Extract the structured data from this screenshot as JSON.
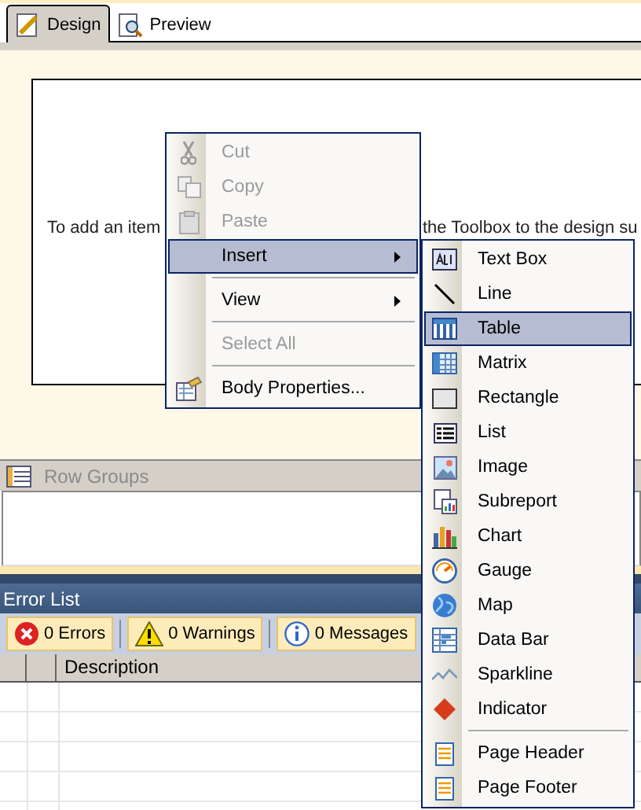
{
  "tabs": [
    {
      "label": "Design",
      "selected": true
    },
    {
      "label": "Preview",
      "selected": false
    }
  ],
  "canvas": {
    "hint_left": "To add an item",
    "hint_right": "the Toolbox to the design su"
  },
  "context_menu": [
    {
      "kind": "item",
      "label": "Cut",
      "disabled": true,
      "selected": false,
      "submenu": false
    },
    {
      "kind": "item",
      "label": "Copy",
      "disabled": true,
      "selected": false,
      "submenu": false
    },
    {
      "kind": "item",
      "label": "Paste",
      "disabled": true,
      "selected": false,
      "submenu": false
    },
    {
      "kind": "item",
      "label": "Insert",
      "disabled": false,
      "selected": true,
      "submenu": true
    },
    {
      "kind": "separator"
    },
    {
      "kind": "item",
      "label": "View",
      "disabled": false,
      "selected": false,
      "submenu": true
    },
    {
      "kind": "separator"
    },
    {
      "kind": "item",
      "label": "Select All",
      "disabled": true,
      "selected": false,
      "submenu": false
    },
    {
      "kind": "separator"
    },
    {
      "kind": "item",
      "label": "Body Properties...",
      "disabled": false,
      "selected": false,
      "submenu": false
    }
  ],
  "insert_submenu": [
    {
      "kind": "item",
      "label": "Text Box",
      "selected": false
    },
    {
      "kind": "item",
      "label": "Line",
      "selected": false
    },
    {
      "kind": "item",
      "label": "Table",
      "selected": true
    },
    {
      "kind": "item",
      "label": "Matrix",
      "selected": false
    },
    {
      "kind": "item",
      "label": "Rectangle",
      "selected": false
    },
    {
      "kind": "item",
      "label": "List",
      "selected": false
    },
    {
      "kind": "item",
      "label": "Image",
      "selected": false
    },
    {
      "kind": "item",
      "label": "Subreport",
      "selected": false
    },
    {
      "kind": "item",
      "label": "Chart",
      "selected": false
    },
    {
      "kind": "item",
      "label": "Gauge",
      "selected": false
    },
    {
      "kind": "item",
      "label": "Map",
      "selected": false
    },
    {
      "kind": "item",
      "label": "Data Bar",
      "selected": false
    },
    {
      "kind": "item",
      "label": "Sparkline",
      "selected": false
    },
    {
      "kind": "item",
      "label": "Indicator",
      "selected": false
    },
    {
      "kind": "separator"
    },
    {
      "kind": "item",
      "label": "Page Header",
      "selected": false
    },
    {
      "kind": "item",
      "label": "Page Footer",
      "selected": false
    }
  ],
  "row_groups": {
    "title": "Row Groups"
  },
  "error_list": {
    "title": "Error List",
    "filters": [
      {
        "label": "0 Errors"
      },
      {
        "label": "0 Warnings"
      },
      {
        "label": "0 Messages"
      }
    ],
    "columns": [
      "Description"
    ]
  }
}
